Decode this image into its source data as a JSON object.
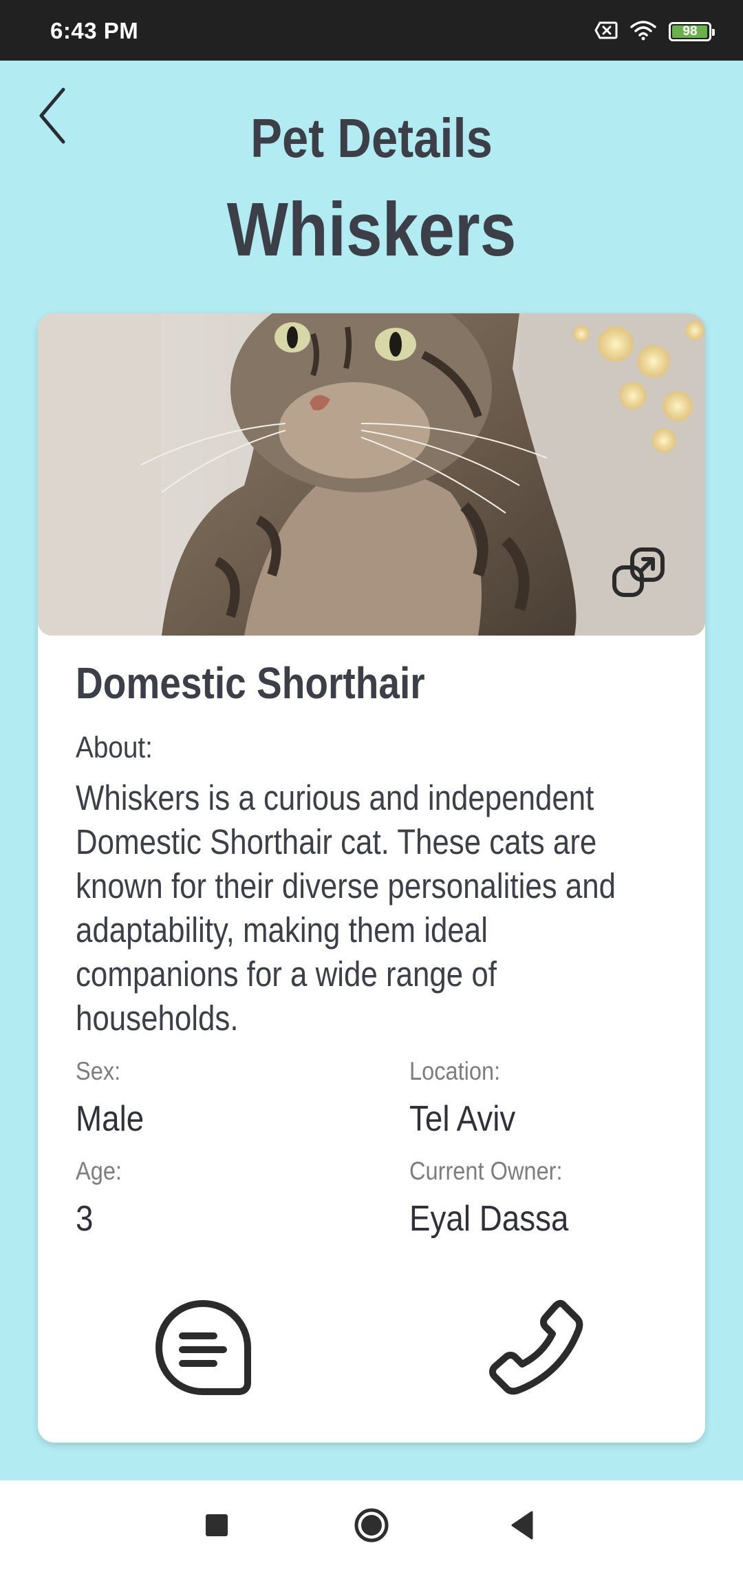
{
  "status_bar": {
    "time": "6:43 PM",
    "battery_level": "98",
    "battery_fraction": 0.98,
    "icons": [
      "sim-error-icon",
      "wifi-icon",
      "battery-icon"
    ]
  },
  "header": {
    "back_icon": "chevron-left-icon",
    "title": "Pet Details",
    "pet_name": "Whiskers"
  },
  "card": {
    "photo_description_icon": "expand-icon",
    "breed": "Domestic Shorthair",
    "about_label": "About:",
    "about_text": "Whiskers is a curious and independent Domestic Shorthair cat. These cats are known for their diverse personalities and adaptability, making them ideal companions for a wide range of households.",
    "details": {
      "sex_label": "Sex:",
      "sex_value": "Male",
      "location_label": "Location:",
      "location_value": "Tel Aviv",
      "age_label": "Age:",
      "age_value": "3",
      "owner_label": "Current Owner:",
      "owner_value": "Eyal Dassa"
    },
    "actions": {
      "chat_icon": "chat-bubble-icon",
      "call_icon": "phone-icon"
    }
  },
  "nav_bar": {
    "icons": [
      "recents-square-icon",
      "home-circle-icon",
      "back-triangle-icon"
    ]
  },
  "colors": {
    "background": "#b2ebf2",
    "text_dark": "#3c3f48",
    "label_gray": "#7d7d7d",
    "status_bar": "#212121",
    "battery_green": "#6ab04c"
  }
}
